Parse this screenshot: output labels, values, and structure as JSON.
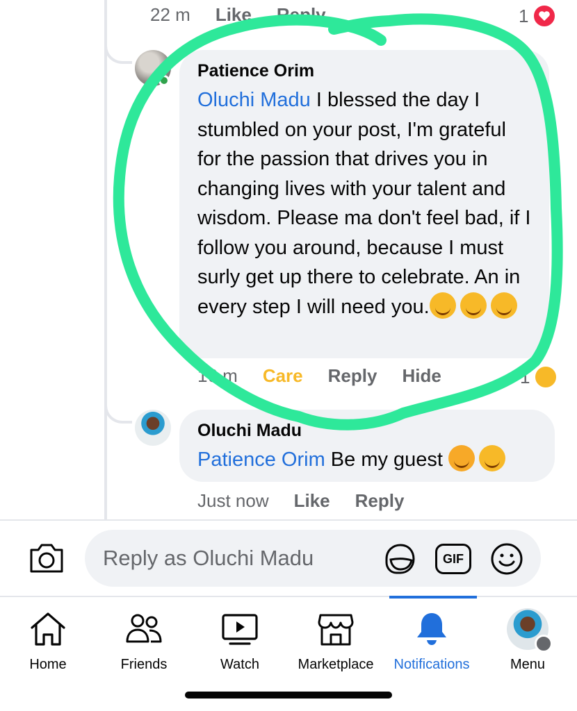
{
  "top_meta": {
    "time": "22 m",
    "like": "Like",
    "reply": "Reply",
    "reaction_count": "1"
  },
  "comment_1": {
    "author": "Patience Orim",
    "mention": "Oluchi Madu",
    "text": " I blessed the day I stumbled on your post, I'm grateful for the passion that drives you in changing lives with your talent and wisdom. Please ma don't feel bad, if I follow you around, because I must surly get up there to celebrate. An in every step I will need you.",
    "time": "16 m",
    "reaction_label": "Care",
    "reply": "Reply",
    "hide": "Hide",
    "reaction_count": "1"
  },
  "comment_2": {
    "author": "Oluchi Madu",
    "mention": "Patience Orim",
    "text": " Be my guest ",
    "time": "Just now",
    "like": "Like",
    "reply": "Reply"
  },
  "composer": {
    "placeholder": "Reply as Oluchi Madu",
    "gif": "GIF"
  },
  "tabs": [
    {
      "label": "Home",
      "icon": "home-icon"
    },
    {
      "label": "Friends",
      "icon": "friends-icon"
    },
    {
      "label": "Watch",
      "icon": "watch-icon"
    },
    {
      "label": "Marketplace",
      "icon": "marketplace-icon"
    },
    {
      "label": "Notifications",
      "icon": "bell-icon",
      "active": true
    },
    {
      "label": "Menu",
      "icon": "avatar"
    }
  ],
  "colors": {
    "link": "#216fdb",
    "care": "#f7b928",
    "highlight": "#2ee89a",
    "bubble": "#f0f2f5",
    "muted": "#65676b"
  }
}
